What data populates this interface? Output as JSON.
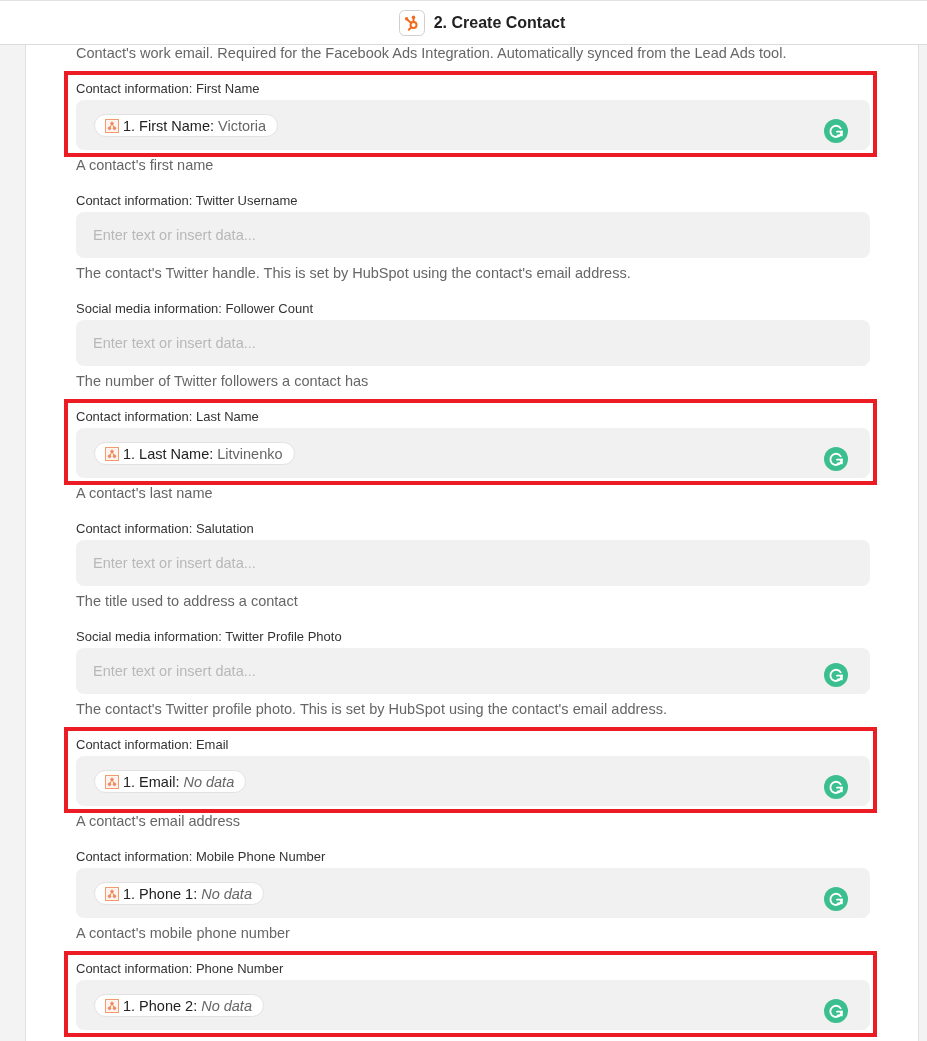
{
  "header": {
    "title": "2. Create Contact"
  },
  "preceding_description": "Contact's work email. Required for the Facebook Ads Integration. Automatically synced from the Lead Ads tool.",
  "fields": [
    {
      "label": "Contact information: First Name",
      "pill": {
        "label": "1. First Name:",
        "value": "Victoria",
        "kind": "data"
      },
      "description": "A contact's first name",
      "highlighted": true,
      "assistant_icon": true
    },
    {
      "label": "Contact information: Twitter Username",
      "placeholder": "Enter text or insert data...",
      "description": "The contact's Twitter handle. This is set by HubSpot using the contact's email address.",
      "highlighted": false,
      "assistant_icon": false
    },
    {
      "label": "Social media information: Follower Count",
      "placeholder": "Enter text or insert data...",
      "description": "The number of Twitter followers a contact has",
      "highlighted": false,
      "assistant_icon": false
    },
    {
      "label": "Contact information: Last Name",
      "pill": {
        "label": "1. Last Name:",
        "value": "Litvinenko",
        "kind": "data"
      },
      "description": "A contact's last name",
      "highlighted": true,
      "assistant_icon": true
    },
    {
      "label": "Contact information: Salutation",
      "placeholder": "Enter text or insert data...",
      "description": "The title used to address a contact",
      "highlighted": false,
      "assistant_icon": false
    },
    {
      "label": "Social media information: Twitter Profile Photo",
      "placeholder": "Enter text or insert data...",
      "description": "The contact's Twitter profile photo. This is set by HubSpot using the contact's email address.",
      "highlighted": false,
      "assistant_icon": true
    },
    {
      "label": "Contact information: Email",
      "pill": {
        "label": "1. Email:",
        "value": "No data",
        "kind": "no_data"
      },
      "description": "A contact's email address",
      "highlighted": true,
      "assistant_icon": true
    },
    {
      "label": "Contact information: Mobile Phone Number",
      "pill": {
        "label": "1. Phone 1:",
        "value": "No data",
        "kind": "no_data"
      },
      "description": "A contact's mobile phone number",
      "highlighted": false,
      "assistant_icon": true
    },
    {
      "label": "Contact information: Phone Number",
      "pill": {
        "label": "1. Phone 2:",
        "value": "No data",
        "kind": "no_data"
      },
      "highlighted": true,
      "assistant_icon": true
    }
  ]
}
